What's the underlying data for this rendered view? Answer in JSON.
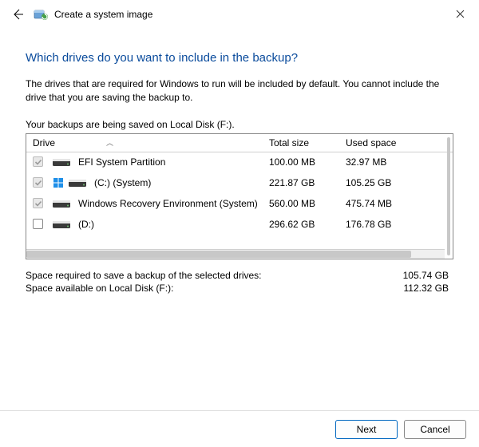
{
  "titlebar": {
    "title": "Create a system image"
  },
  "heading": "Which drives do you want to include in the backup?",
  "description": "The drives that are required for Windows to run will be included by default. You cannot include the drive that you are saving the backup to.",
  "saving_on": "Your backups are being saved on Local Disk (F:).",
  "columns": {
    "drive": "Drive",
    "total": "Total size",
    "used": "Used space"
  },
  "rows": [
    {
      "label": "EFI System Partition",
      "total": "100.00 MB",
      "used": "32.97 MB",
      "checked": true,
      "disabled": true,
      "system_badge": false
    },
    {
      "label": "(C:) (System)",
      "total": "221.87 GB",
      "used": "105.25 GB",
      "checked": true,
      "disabled": true,
      "system_badge": true
    },
    {
      "label": "Windows Recovery Environment (System)",
      "total": "560.00 MB",
      "used": "475.74 MB",
      "checked": true,
      "disabled": true,
      "system_badge": false
    },
    {
      "label": "(D:)",
      "total": "296.62 GB",
      "used": "176.78 GB",
      "checked": false,
      "disabled": false,
      "system_badge": false
    }
  ],
  "summary": {
    "required_label": "Space required to save a backup of the selected drives:",
    "required_value": "105.74 GB",
    "available_label": "Space available on Local Disk (F:):",
    "available_value": "112.32 GB"
  },
  "buttons": {
    "next": "Next",
    "cancel": "Cancel"
  }
}
